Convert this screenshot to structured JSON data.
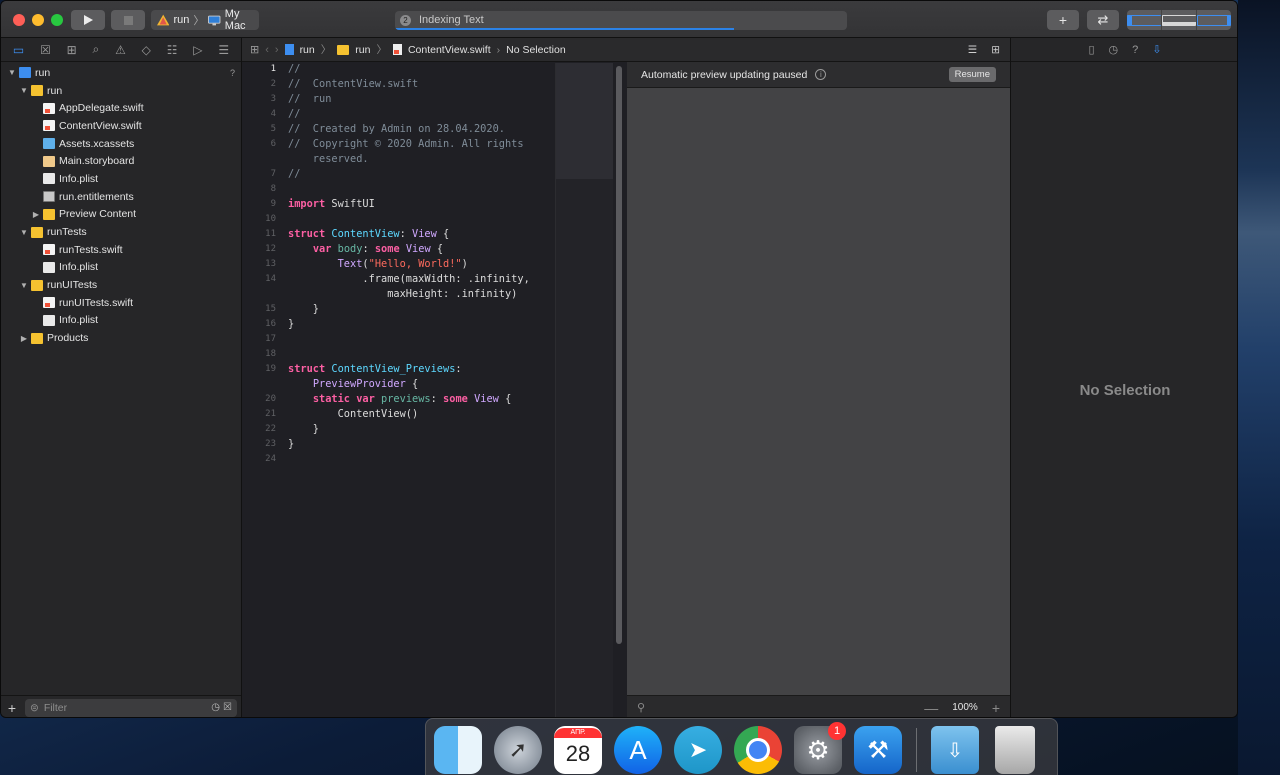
{
  "toolbar": {
    "scheme_target": "run",
    "scheme_device": "My Mac",
    "status_badge": "2",
    "status_text": "Indexing Text",
    "status_progress": 0.75
  },
  "navigator": {
    "items": [
      {
        "label": "run",
        "indent": 0,
        "disclosure": "open",
        "icon": "project",
        "badge": "?"
      },
      {
        "label": "run",
        "indent": 1,
        "disclosure": "open",
        "icon": "folder"
      },
      {
        "label": "AppDelegate.swift",
        "indent": 2,
        "disclosure": "",
        "icon": "swift"
      },
      {
        "label": "ContentView.swift",
        "indent": 2,
        "disclosure": "",
        "icon": "swift"
      },
      {
        "label": "Assets.xcassets",
        "indent": 2,
        "disclosure": "",
        "icon": "assets"
      },
      {
        "label": "Main.storyboard",
        "indent": 2,
        "disclosure": "",
        "icon": "storyboard"
      },
      {
        "label": "Info.plist",
        "indent": 2,
        "disclosure": "",
        "icon": "plist"
      },
      {
        "label": "run.entitlements",
        "indent": 2,
        "disclosure": "",
        "icon": "entitlements"
      },
      {
        "label": "Preview Content",
        "indent": 2,
        "disclosure": "closed",
        "icon": "folder"
      },
      {
        "label": "runTests",
        "indent": 1,
        "disclosure": "open",
        "icon": "folder"
      },
      {
        "label": "runTests.swift",
        "indent": 2,
        "disclosure": "",
        "icon": "swift"
      },
      {
        "label": "Info.plist",
        "indent": 2,
        "disclosure": "",
        "icon": "plist"
      },
      {
        "label": "runUITests",
        "indent": 1,
        "disclosure": "open",
        "icon": "folder"
      },
      {
        "label": "runUITests.swift",
        "indent": 2,
        "disclosure": "",
        "icon": "swift"
      },
      {
        "label": "Info.plist",
        "indent": 2,
        "disclosure": "",
        "icon": "plist"
      },
      {
        "label": "Products",
        "indent": 1,
        "disclosure": "closed",
        "icon": "folder"
      }
    ],
    "filter_placeholder": "Filter"
  },
  "jumpbar": {
    "items": [
      "run",
      "run",
      "ContentView.swift",
      "No Selection"
    ]
  },
  "editor": {
    "lines": [
      {
        "n": "1",
        "html": "<span class='cm'>//</span>",
        "current": true
      },
      {
        "n": "2",
        "html": "<span class='cm'>//  ContentView.swift</span>"
      },
      {
        "n": "3",
        "html": "<span class='cm'>//  run</span>"
      },
      {
        "n": "4",
        "html": "<span class='cm'>//</span>"
      },
      {
        "n": "5",
        "html": "<span class='cm'>//  Created by Admin on 28.04.2020.</span>"
      },
      {
        "n": "6",
        "html": "<span class='cm'>//  Copyright © 2020 Admin. All rights</span>"
      },
      {
        "n": "",
        "html": "<span class='cm'>    reserved.</span>"
      },
      {
        "n": "7",
        "html": "<span class='cm'>//</span>"
      },
      {
        "n": "8",
        "html": ""
      },
      {
        "n": "9",
        "html": "<span class='kw'>import</span> SwiftUI"
      },
      {
        "n": "10",
        "html": ""
      },
      {
        "n": "11",
        "html": "<span class='kw'>struct</span> <span class='ty2'>ContentView</span>: <span class='ty'>View</span> {"
      },
      {
        "n": "12",
        "html": "    <span class='kw'>var</span> <span class='pr'>body</span>: <span class='kw'>some</span> <span class='ty'>View</span> {"
      },
      {
        "n": "13",
        "html": "        <span class='ty'>Text</span>(<span class='st'>\"Hello, World!\"</span>)"
      },
      {
        "n": "14",
        "html": "            .frame(maxWidth: .infinity,"
      },
      {
        "n": "",
        "html": "                maxHeight: .infinity)"
      },
      {
        "n": "15",
        "html": "    }"
      },
      {
        "n": "16",
        "html": "}"
      },
      {
        "n": "17",
        "html": ""
      },
      {
        "n": "18",
        "html": ""
      },
      {
        "n": "19",
        "html": "<span class='kw'>struct</span> <span class='ty2'>ContentView_Previews</span>:"
      },
      {
        "n": "",
        "html": "    <span class='ty'>PreviewProvider</span> {"
      },
      {
        "n": "20",
        "html": "    <span class='kw'>static</span> <span class='kw'>var</span> <span class='pr'>previews</span>: <span class='kw'>some</span> <span class='ty'>View</span> {"
      },
      {
        "n": "21",
        "html": "        ContentView()"
      },
      {
        "n": "22",
        "html": "    }"
      },
      {
        "n": "23",
        "html": "}"
      },
      {
        "n": "24",
        "html": ""
      }
    ]
  },
  "canvas": {
    "message": "Automatic preview updating paused",
    "resume_label": "Resume",
    "zoom_label": "100%"
  },
  "inspector": {
    "empty_label": "No Selection"
  },
  "dock": {
    "calendar_month": "АПР.",
    "calendar_day": "28",
    "prefs_badge": "1"
  }
}
